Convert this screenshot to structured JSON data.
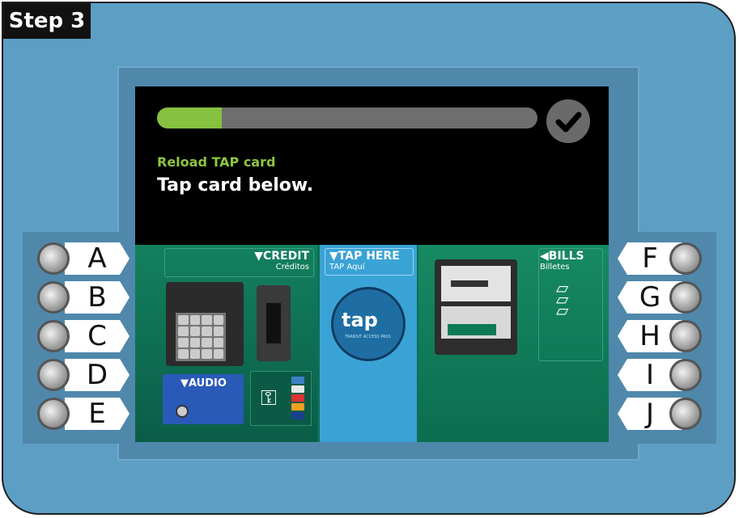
{
  "step": {
    "label": "Step 3"
  },
  "screen": {
    "progress_fraction": 0.17,
    "subtitle": "Reload TAP card",
    "instruction": "Tap card below.",
    "check_icon": "check-circle-icon"
  },
  "machine": {
    "credit": {
      "label": "▼CREDIT",
      "sublabel": "Créditos"
    },
    "audio": {
      "label": "▼AUDIO"
    },
    "tap": {
      "label": "▼TAP HERE",
      "sublabel": "TAP Aquí",
      "logo": "tap",
      "tagline": "TRANSIT ACCESS PASS"
    },
    "bills": {
      "label": "◀BILLS",
      "sublabel": "Billetes"
    }
  },
  "buttons_left": [
    "A",
    "B",
    "C",
    "D",
    "E"
  ],
  "buttons_right": [
    "F",
    "G",
    "H",
    "I",
    "J"
  ],
  "colors": {
    "panel": "#5d9ec4",
    "progress": "#86c13f",
    "subtitle": "#8dc63f"
  }
}
